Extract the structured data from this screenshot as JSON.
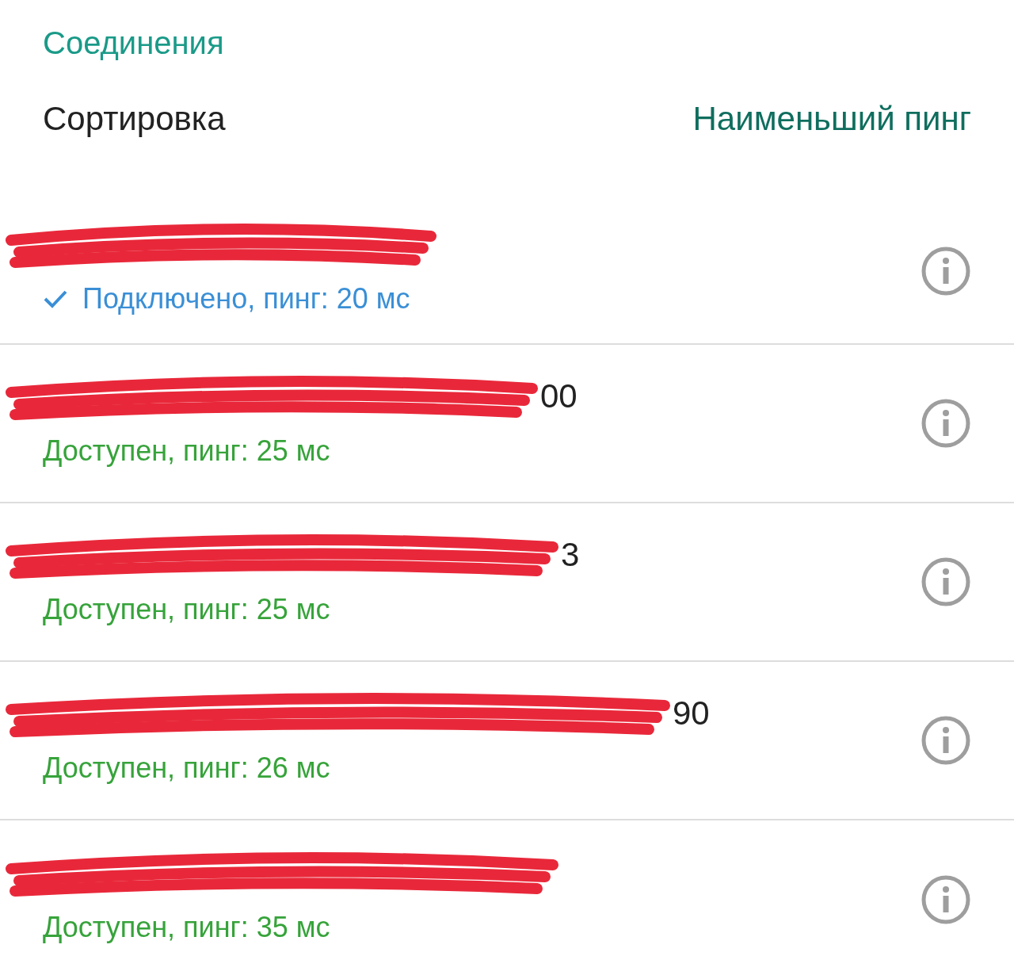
{
  "section_title": "Соединения",
  "sort": {
    "label": "Сортировка",
    "value": "Наименьший пинг"
  },
  "connections": [
    {
      "status": "Подключено, пинг: 20 мс",
      "kind": "connected"
    },
    {
      "name_fragment": "00",
      "status": "Доступен, пинг: 25 мс",
      "kind": "available"
    },
    {
      "name_fragment": "3",
      "status": "Доступен, пинг: 25 мс",
      "kind": "available"
    },
    {
      "name_fragment": "90",
      "status": "Доступен, пинг: 26 мс",
      "kind": "available"
    },
    {
      "status": "Доступен, пинг: 35 мс",
      "kind": "available"
    }
  ]
}
